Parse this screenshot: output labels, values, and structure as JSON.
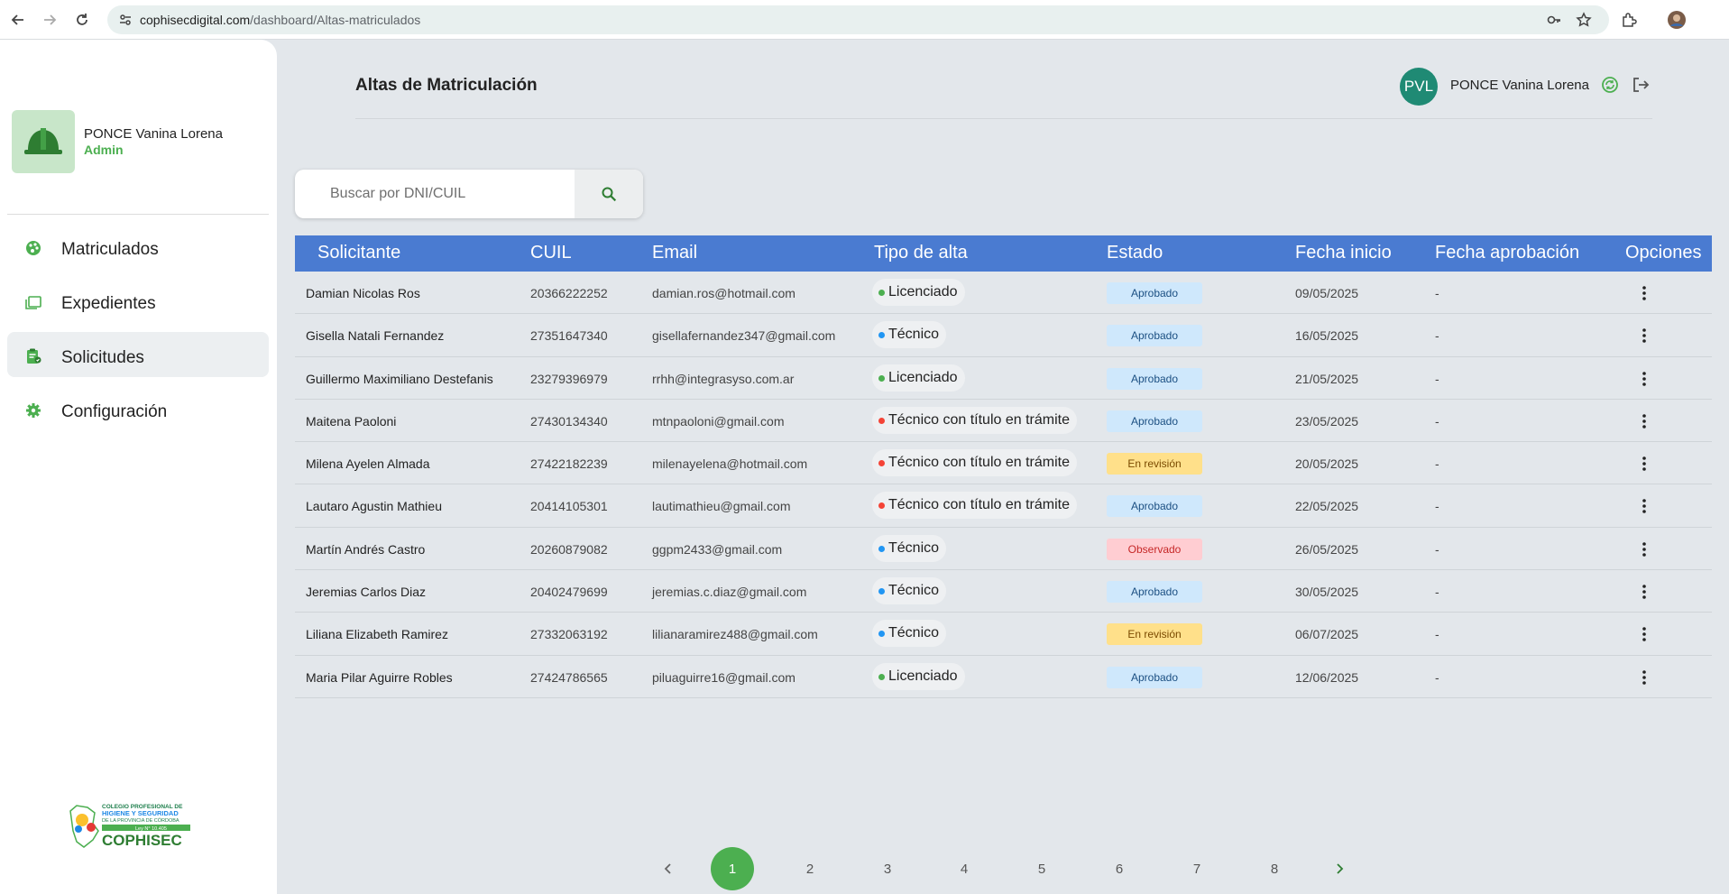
{
  "browser": {
    "url_domain": "cophisecdigital.com",
    "url_path": "/dashboard/Altas-matriculados"
  },
  "sidebar": {
    "user_name": "PONCE Vanina Lorena",
    "user_role": "Admin",
    "items": [
      {
        "label": "Matriculados",
        "icon": "palette-icon"
      },
      {
        "label": "Expedientes",
        "icon": "folders-icon"
      },
      {
        "label": "Solicitudes",
        "icon": "clipboard-icon",
        "active": true
      },
      {
        "label": "Configuración",
        "icon": "gear-icon"
      }
    ],
    "footer_logo_text": "COPHISEC",
    "footer_logo_subtitle": "COLEGIO PROFESIONAL DE HIGIENE Y SEGURIDAD DE LA PROVINCIA DE CÓRDOBA",
    "footer_logo_law": "Ley N° 10.405"
  },
  "header": {
    "title": "Altas de Matriculación",
    "avatar_initials": "PVL",
    "user_name": "PONCE Vanina Lorena"
  },
  "search": {
    "placeholder": "Buscar por DNI/CUIL"
  },
  "table": {
    "columns": [
      "Solicitante",
      "CUIL",
      "Email",
      "Tipo de alta",
      "Estado",
      "Fecha inicio",
      "Fecha aprobación",
      "Opciones"
    ],
    "rows": [
      {
        "solicitante": "Damian Nicolas Ros",
        "cuil": "20366222252",
        "email": "damian.ros@hotmail.com",
        "tipo": "Licenciado",
        "estado": "Aprobado",
        "inicio": "09/05/2025",
        "aprobacion": "-"
      },
      {
        "solicitante": "Gisella Natali Fernandez",
        "cuil": "27351647340",
        "email": "gisellafernandez347@gmail.com",
        "tipo": "Técnico",
        "estado": "Aprobado",
        "inicio": "16/05/2025",
        "aprobacion": "-"
      },
      {
        "solicitante": "Guillermo Maximiliano Destefanis",
        "cuil": "23279396979",
        "email": "rrhh@integrasyso.com.ar",
        "tipo": "Licenciado",
        "estado": "Aprobado",
        "inicio": "21/05/2025",
        "aprobacion": "-"
      },
      {
        "solicitante": "Maitena Paoloni",
        "cuil": "27430134340",
        "email": "mtnpaoloni@gmail.com",
        "tipo": "Técnico con título en trámite",
        "estado": "Aprobado",
        "inicio": "23/05/2025",
        "aprobacion": "-"
      },
      {
        "solicitante": "Milena Ayelen Almada",
        "cuil": "27422182239",
        "email": "milenayelena@hotmail.com",
        "tipo": "Técnico con título en trámite",
        "estado": "En revisión",
        "inicio": "20/05/2025",
        "aprobacion": "-"
      },
      {
        "solicitante": "Lautaro Agustin Mathieu",
        "cuil": "20414105301",
        "email": "lautimathieu@gmail.com",
        "tipo": "Técnico con título en trámite",
        "estado": "Aprobado",
        "inicio": "22/05/2025",
        "aprobacion": "-"
      },
      {
        "solicitante": "Martín Andrés Castro",
        "cuil": "20260879082",
        "email": "ggpm2433@gmail.com",
        "tipo": "Técnico",
        "estado": "Observado",
        "inicio": "26/05/2025",
        "aprobacion": "-"
      },
      {
        "solicitante": "Jeremias Carlos Diaz",
        "cuil": "20402479699",
        "email": "jeremias.c.diaz@gmail.com",
        "tipo": "Técnico",
        "estado": "Aprobado",
        "inicio": "30/05/2025",
        "aprobacion": "-"
      },
      {
        "solicitante": "Liliana Elizabeth Ramirez",
        "cuil": "27332063192",
        "email": "lilianaramirez488@gmail.com",
        "tipo": "Técnico",
        "estado": "En revisión",
        "inicio": "06/07/2025",
        "aprobacion": "-"
      },
      {
        "solicitante": "Maria Pilar Aguirre Robles",
        "cuil": "27424786565",
        "email": "piluaguirre16@gmail.com",
        "tipo": "Licenciado",
        "estado": "Aprobado",
        "inicio": "12/06/2025",
        "aprobacion": "-"
      }
    ],
    "tipo_dot_colors": {
      "Licenciado": "#4caf50",
      "Técnico": "#2196f3",
      "Técnico con título en trámite": "#f44336"
    },
    "estado_styles": {
      "Aprobado": {
        "bg": "#cfe8fc",
        "fg": "#1b4f82"
      },
      "En revisión": {
        "bg": "#ffe08a",
        "fg": "#7a4a00"
      },
      "Observado": {
        "bg": "#ffcdd2",
        "fg": "#c62828"
      }
    }
  },
  "pagination": {
    "pages": [
      "1",
      "2",
      "3",
      "4",
      "5",
      "6",
      "7",
      "8"
    ],
    "current": "1"
  },
  "colors": {
    "accent_green": "#4caf50",
    "header_blue": "#4a7bd1",
    "avatar_teal": "#1f8a74"
  }
}
